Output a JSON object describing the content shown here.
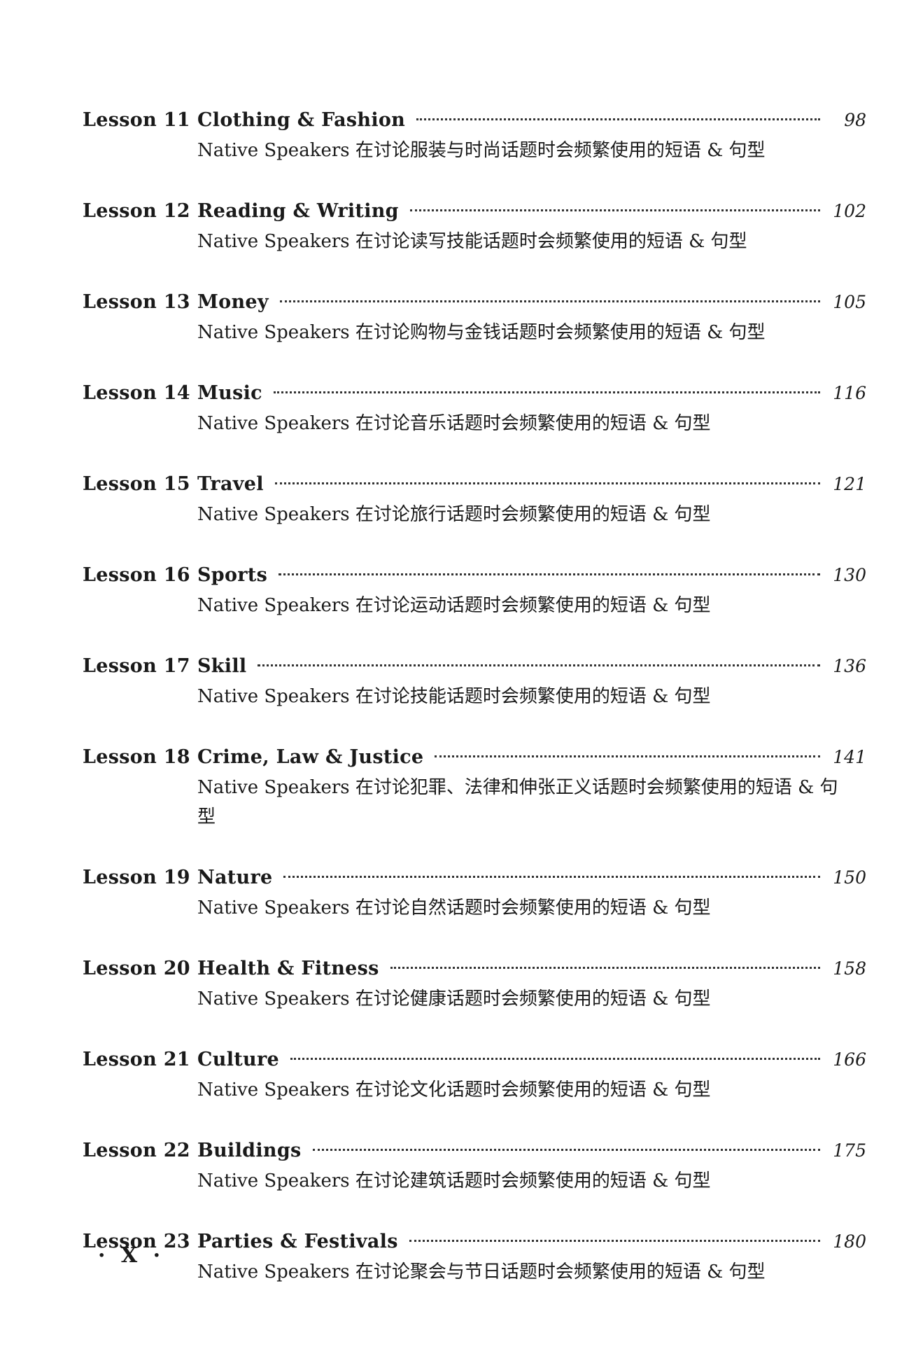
{
  "entries": [
    {
      "lesson": "Lesson 11",
      "title": "Clothing & Fashion",
      "page": "98",
      "desc": "Native Speakers 在讨论服装与时尚话题时会频繁使用的短语 & 句型"
    },
    {
      "lesson": "Lesson 12",
      "title": "Reading & Writing",
      "page": "102",
      "desc": "Native Speakers 在讨论读写技能话题时会频繁使用的短语 & 句型"
    },
    {
      "lesson": "Lesson 13",
      "title": "Money",
      "page": "105",
      "desc": "Native Speakers 在讨论购物与金钱话题时会频繁使用的短语 & 句型"
    },
    {
      "lesson": "Lesson 14",
      "title": "Music",
      "page": "116",
      "desc": "Native Speakers 在讨论音乐话题时会频繁使用的短语 & 句型"
    },
    {
      "lesson": "Lesson 15",
      "title": "Travel",
      "page": "121",
      "desc": "Native Speakers 在讨论旅行话题时会频繁使用的短语 & 句型"
    },
    {
      "lesson": "Lesson 16",
      "title": "Sports",
      "page": "130",
      "desc": "Native Speakers 在讨论运动话题时会频繁使用的短语 & 句型"
    },
    {
      "lesson": "Lesson 17",
      "title": "Skill",
      "page": "136",
      "desc": "Native Speakers 在讨论技能话题时会频繁使用的短语 & 句型"
    },
    {
      "lesson": "Lesson 18",
      "title": "Crime, Law & Justice",
      "page": "141",
      "desc": "Native Speakers 在讨论犯罪、法律和伸张正义话题时会频繁使用的短语 & 句型"
    },
    {
      "lesson": "Lesson 19",
      "title": "Nature",
      "page": "150",
      "desc": "Native Speakers 在讨论自然话题时会频繁使用的短语 & 句型"
    },
    {
      "lesson": "Lesson 20",
      "title": "Health & Fitness",
      "page": "158",
      "desc": "Native Speakers 在讨论健康话题时会频繁使用的短语 & 句型"
    },
    {
      "lesson": "Lesson 21",
      "title": "Culture",
      "page": "166",
      "desc": "Native Speakers 在讨论文化话题时会频繁使用的短语 & 句型"
    },
    {
      "lesson": "Lesson 22",
      "title": "Buildings",
      "page": "175",
      "desc": "Native Speakers 在讨论建筑话题时会频繁使用的短语 & 句型"
    },
    {
      "lesson": "Lesson 23",
      "title": "Parties & Festivals",
      "page": "180",
      "desc": "Native Speakers 在讨论聚会与节日话题时会频繁使用的短语 & 句型"
    }
  ],
  "folio": "· X ·"
}
